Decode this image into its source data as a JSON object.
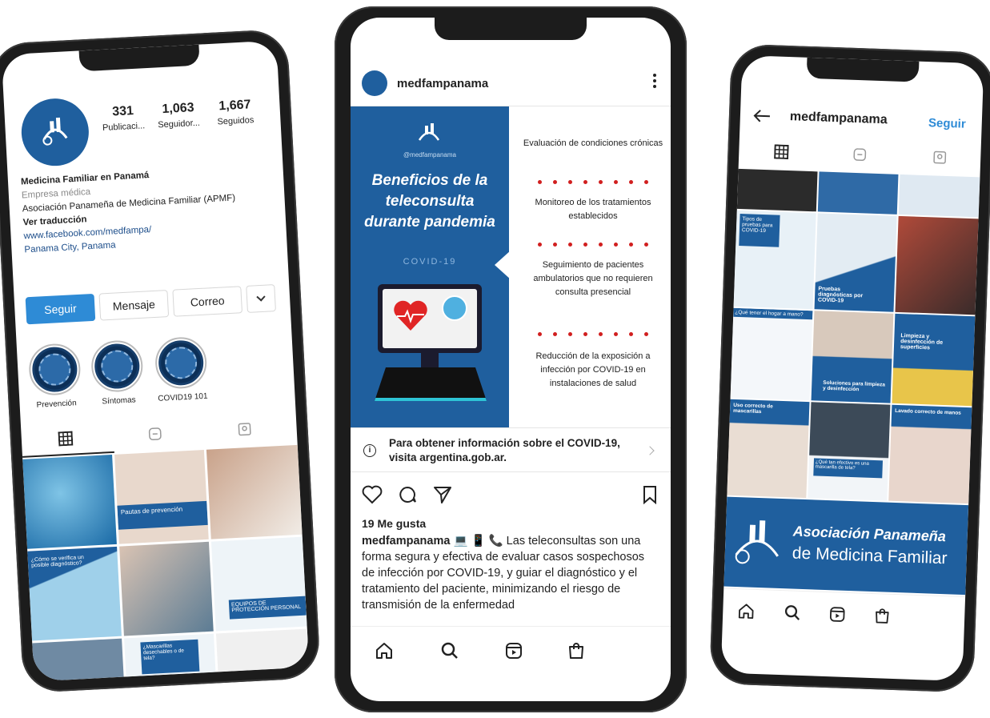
{
  "profile_phone": {
    "stats": [
      {
        "value": "331",
        "label": "Publicaci..."
      },
      {
        "value": "1,063",
        "label": "Seguidor..."
      },
      {
        "value": "1,667",
        "label": "Seguidos"
      }
    ],
    "name": "Medicina Familiar en Panamá",
    "category": "Empresa médica",
    "bio": "Asociación Panameña de Medicina Familiar (APMF)",
    "translate": "Ver traducción",
    "link": "www.facebook.com/medfampa/",
    "location": "Panama City, Panama",
    "buttons": {
      "follow": "Seguir",
      "message": "Mensaje",
      "email": "Correo"
    },
    "highlights": [
      "Prevención",
      "Síntomas",
      "COVID19 101"
    ],
    "grid_captions": [
      "Pautas de prevención",
      "¿Cómo se verifica un posible diagnóstico?",
      "EQUIPOS DE PROTECCIÓN PERSONAL",
      "¿Mascarillas desechables o de tela?"
    ]
  },
  "post_phone": {
    "username": "medfampanama",
    "post": {
      "brand": "@medfampanama",
      "headline": "Beneficios de la teleconsulta durante pandemia",
      "tag": "COVID-19",
      "benefits": [
        "Evaluación de condiciones crónicas",
        "Monitoreo de los tratamientos establecidos",
        "Seguimiento de pacientes ambulatorios que no requieren consulta presencial",
        "Reducción de la exposición a infección por COVID-19 en instalaciones de salud"
      ]
    },
    "covid_notice": "Para obtener información sobre el COVID-19, visita argentina.gob.ar.",
    "likes": "19 Me gusta",
    "caption_user": "medfampanama",
    "caption_text": "💻 📱 📞 Las teleconsultas son una forma segura y efectiva de evaluar casos sospechosos de infección por COVID-19, y guiar el diagnóstico y el tratamiento del paciente, minimizando el riesgo de transmisión de la enfermedad"
  },
  "feed_phone": {
    "username": "medfampanama",
    "follow": "Seguir",
    "tiles": [
      "Tipos de pruebas para COVID-19",
      "Pruebas diagnósticas por COVID-19",
      "¿Qué tener el hogar a mano?",
      "Limpieza y desinfección de superficies",
      "Soluciones para limpieza y desinfección",
      "Uso correcto de mascarillas",
      "¿Qué tan efectivo es una mascarilla de tela?",
      "Lavado correcto de manos"
    ],
    "banner_line1": "Asociación Panameña",
    "banner_line2": "de Medicina Familiar"
  },
  "colors": {
    "brand_blue": "#1f5f9e",
    "follow_blue": "#2e8bd6",
    "alert_red": "#d11f1f"
  }
}
